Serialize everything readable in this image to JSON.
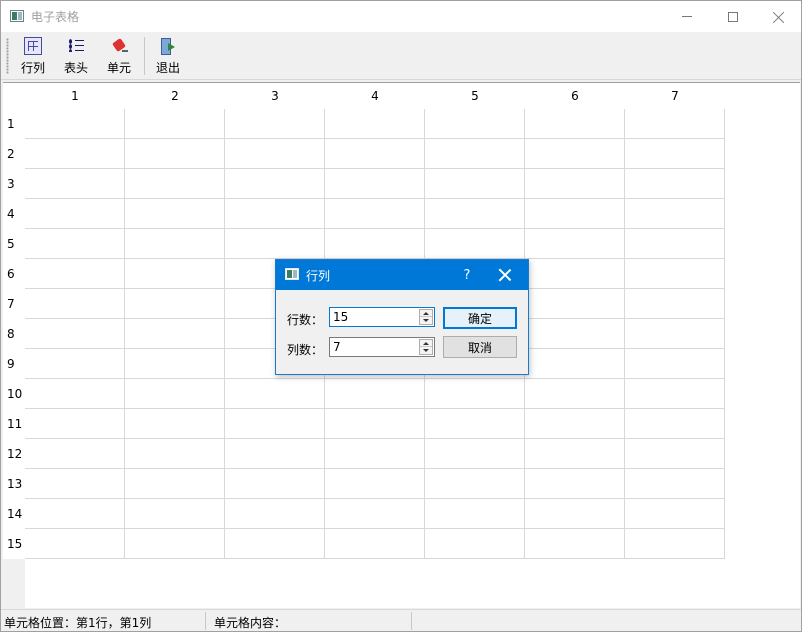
{
  "window": {
    "title": "电子表格"
  },
  "toolbar": {
    "buttons": [
      {
        "label": "行列",
        "icon": "row-column-icon"
      },
      {
        "label": "表头",
        "icon": "list-header-icon"
      },
      {
        "label": "单元",
        "icon": "cell-icon"
      },
      {
        "label": "退出",
        "icon": "exit-door-icon"
      }
    ]
  },
  "table": {
    "column_headers": [
      "1",
      "2",
      "3",
      "4",
      "5",
      "6",
      "7"
    ],
    "row_headers": [
      "1",
      "2",
      "3",
      "4",
      "5",
      "6",
      "7",
      "8",
      "9",
      "10",
      "11",
      "12",
      "13",
      "14",
      "15"
    ]
  },
  "statusbar": {
    "position_text": "单元格位置：第1行，第1列",
    "content_text": "单元格内容："
  },
  "dialog": {
    "title": "行列",
    "help_glyph": "?",
    "rows_label": "行数：",
    "rows_value": "15",
    "cols_label": "列数：",
    "cols_value": "7",
    "ok_label": "确定",
    "cancel_label": "取消"
  }
}
